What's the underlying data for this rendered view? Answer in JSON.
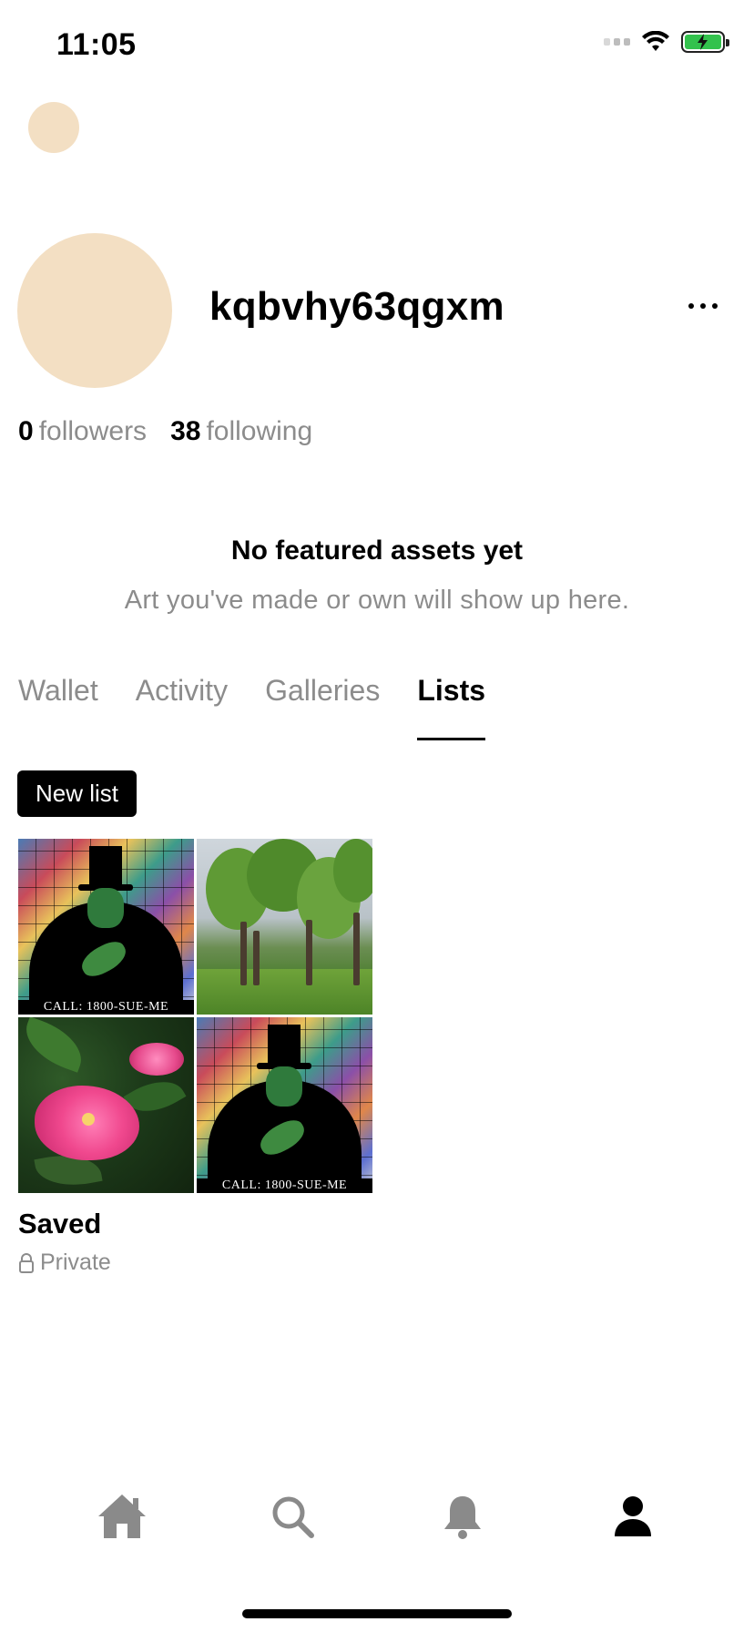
{
  "status_bar": {
    "time": "11:05"
  },
  "profile": {
    "username": "kqbvhy63qgxm",
    "followers_count": "0",
    "followers_label": "followers",
    "following_count": "38",
    "following_label": "following",
    "avatar_color": "#f3dfc3"
  },
  "empty_state": {
    "title": "No featured assets yet",
    "subtitle": "Art you've made or own will show up here."
  },
  "tabs": [
    {
      "label": "Wallet",
      "active": false
    },
    {
      "label": "Activity",
      "active": false
    },
    {
      "label": "Galleries",
      "active": false
    },
    {
      "label": "Lists",
      "active": true
    }
  ],
  "actions": {
    "new_list_label": "New list"
  },
  "lists": [
    {
      "title": "Saved",
      "privacy": "Private",
      "thumbnails": [
        {
          "caption": "CALL: 1800-SUE-ME"
        },
        {
          "caption": ""
        },
        {
          "caption": ""
        },
        {
          "caption": "CALL: 1800-SUE-ME"
        }
      ]
    }
  ],
  "bottom_nav": {
    "items": [
      "home-icon",
      "search-icon",
      "bell-icon",
      "profile-icon"
    ],
    "active": "profile-icon",
    "active_color": "#000000",
    "inactive_color": "#8a8a8a"
  }
}
